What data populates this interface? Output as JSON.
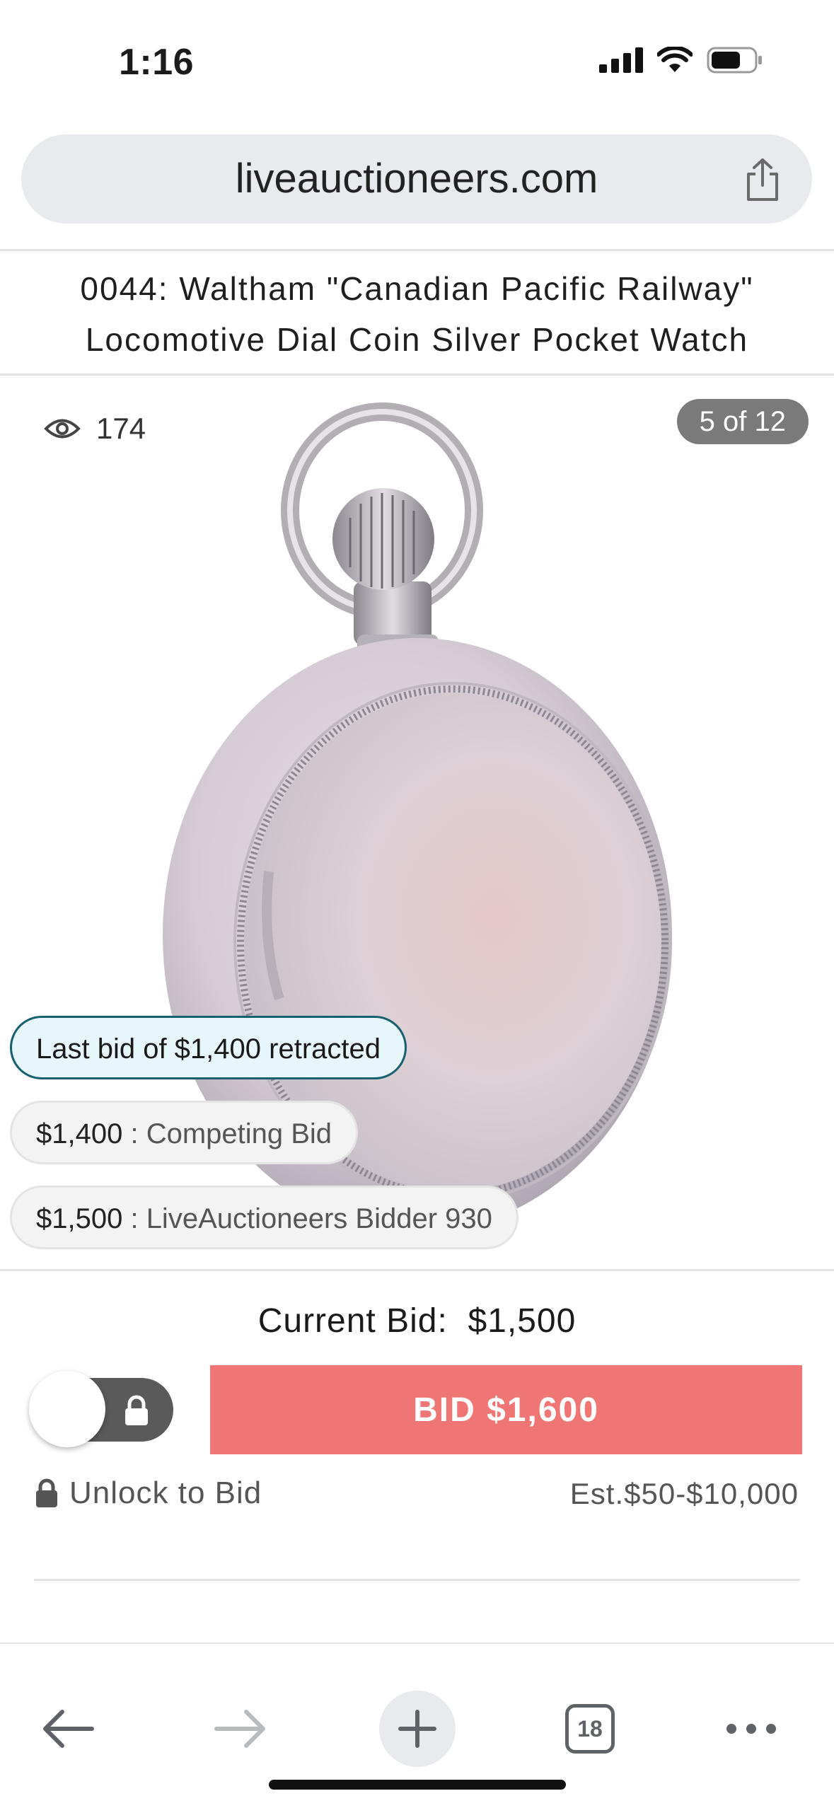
{
  "status_bar": {
    "time": "1:16"
  },
  "browser": {
    "url": "liveauctioneers.com",
    "tab_count": "18"
  },
  "lot": {
    "title": "0044: Waltham \"Canadian Pacific Railway\" Locomotive Dial Coin Silver Pocket Watch",
    "views": "174",
    "image_counter": "5 of 12"
  },
  "bid_feed": {
    "retracted": "Last bid of  $1,400  retracted",
    "bids": [
      {
        "amount": "$1,400",
        "label": "Competing Bid"
      },
      {
        "amount": "$1,500",
        "label": "LiveAuctioneers Bidder 930"
      }
    ]
  },
  "bidding": {
    "current_bid_label": "Current Bid:",
    "current_bid_value": "$1,500",
    "bid_button_label": "BID $1,600",
    "unlock_label": "Unlock to Bid",
    "estimate": "Est.$50-$10,000"
  },
  "colors": {
    "bid_button": "#ef7674",
    "retract_border": "#17606f",
    "counter_bg": "#7a7a7a"
  },
  "icons": [
    "signal-icon",
    "wifi-icon",
    "battery-icon",
    "share-icon",
    "eye-icon",
    "lock-icon",
    "back-arrow-icon",
    "forward-arrow-icon",
    "plus-icon",
    "tabs-icon",
    "more-icon"
  ]
}
